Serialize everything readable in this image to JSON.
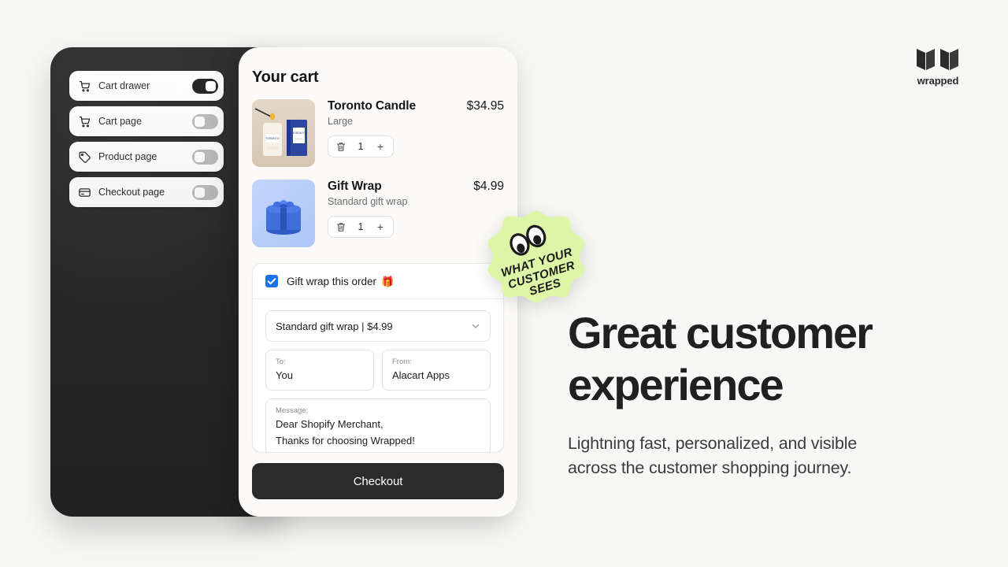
{
  "brand": {
    "logo_icon": "wrapped-ribbon-w-logo",
    "wordmark": "wrapped"
  },
  "device_panel": {
    "surfaces": [
      {
        "label": "Cart drawer",
        "icon": "shopping-cart-icon",
        "enabled": true
      },
      {
        "label": "Cart page",
        "icon": "shopping-cart-icon",
        "enabled": false
      },
      {
        "label": "Product page",
        "icon": "price-tag-icon",
        "enabled": false
      },
      {
        "label": "Checkout page",
        "icon": "credit-card-icon",
        "enabled": false
      }
    ],
    "tap_indicator_icon": "tap-sparkle-icon"
  },
  "cart": {
    "title": "Your cart",
    "items": [
      {
        "name": "Toronto Candle",
        "variant": "Large",
        "price": "$34.95",
        "quantity": "1",
        "plus_label": "+",
        "remove_icon": "trash-icon",
        "thumb_icon": "candle-product-image"
      },
      {
        "name": "Gift Wrap",
        "variant": "Standard gift wrap",
        "price": "$4.99",
        "quantity": "1",
        "plus_label": "+",
        "remove_icon": "trash-icon",
        "thumb_icon": "gift-box-product-image"
      }
    ],
    "checkout_label": "Checkout"
  },
  "gift_wrap": {
    "checkbox_checked": true,
    "checkbox_label": "Gift wrap this order",
    "emoji": "🎁",
    "wrap_option_selected": "Standard gift wrap | $4.99",
    "chevron_icon": "chevron-down-icon",
    "to_label": "To:",
    "to_value": "You",
    "from_label": "From:",
    "from_value": "Alacart Apps",
    "message_label": "Message:",
    "message_line_1": "Dear Shopify Merchant,",
    "message_line_2": "Thanks for choosing Wrapped!"
  },
  "sticker": {
    "line_1": "WHAT YOUR",
    "line_2": "CUSTOMER",
    "line_3": "SEES",
    "eyes_icon": "googly-eyes-icon",
    "fill_color": "#ddf5a6",
    "text_color": "#1b1b1b"
  },
  "hero": {
    "heading_line_1": "Great customer",
    "heading_line_2": "experience",
    "subtext_line_1": "Lightning fast, personalized, and visible",
    "subtext_line_2": "across the customer shopping journey."
  },
  "colors": {
    "page_background": "#f7f7f5",
    "panel_dark": "#262626",
    "sheet_background": "#fbfaf8",
    "checkout_button": "#2b2b2b",
    "checkbox_blue": "#1a73e8",
    "sticker_green": "#ddf5a6"
  }
}
